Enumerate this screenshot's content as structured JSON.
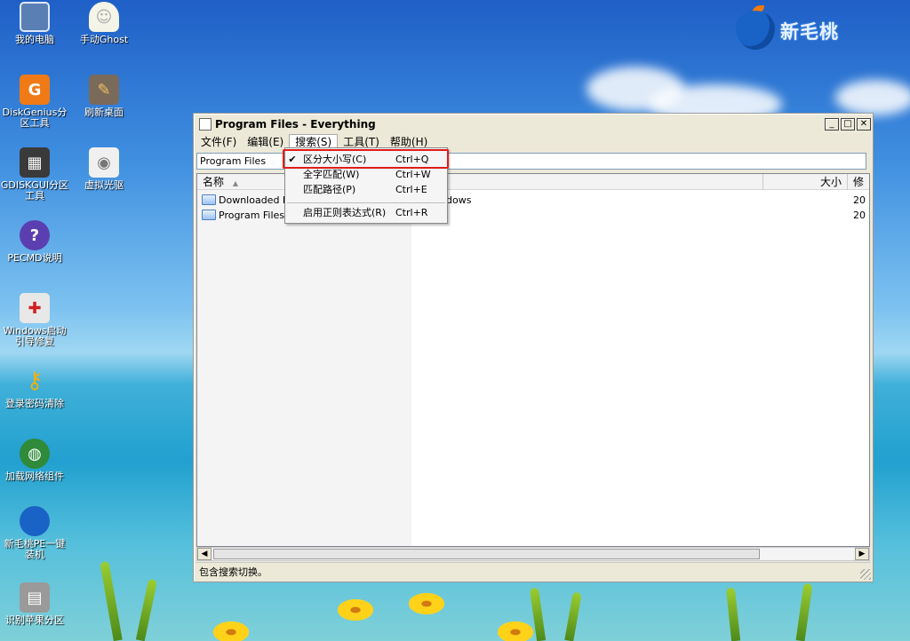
{
  "brand": {
    "name": "新毛桃"
  },
  "desktop_icons": [
    {
      "label": "我的电脑",
      "icon": "computer-icon"
    },
    {
      "label": "手动Ghost",
      "icon": "ghost-icon"
    },
    {
      "label": "DiskGenius分区工具",
      "icon": "diskgenius-icon"
    },
    {
      "label": "刷新桌面",
      "icon": "refresh-desktop-icon"
    },
    {
      "label": "GDISKGUI分区工具",
      "icon": "gdiskgui-icon"
    },
    {
      "label": "虚拟光驱",
      "icon": "virtual-cd-icon"
    },
    {
      "label": "PECMD说明",
      "icon": "help-icon"
    },
    {
      "label": "Windows启动引导修复",
      "icon": "boot-repair-icon"
    },
    {
      "label": "登录密码清除",
      "icon": "key-icon"
    },
    {
      "label": "加载网络组件",
      "icon": "network-icon"
    },
    {
      "label": "新毛桃PE一键装机",
      "icon": "peach-install-icon"
    },
    {
      "label": "识别苹果分区",
      "icon": "mac-partition-icon"
    }
  ],
  "window": {
    "title": "Program Files - Everything",
    "menu": [
      "文件(F)",
      "编辑(E)",
      "搜索(S)",
      "工具(T)",
      "帮助(H)"
    ],
    "search_value": "Program Files",
    "columns": {
      "name": "名称",
      "size": "大小",
      "modified": "修"
    },
    "rows": [
      {
        "name": "Downloaded Pro",
        "path": "dows",
        "date": "20"
      },
      {
        "name": "Program Files",
        "path": "",
        "date": "20"
      }
    ],
    "status": "包含搜索切换。"
  },
  "search_menu": [
    {
      "label": "区分大小写(C)",
      "shortcut": "Ctrl+Q",
      "checked": "✔"
    },
    {
      "label": "全字匹配(W)",
      "shortcut": "Ctrl+W",
      "checked": ""
    },
    {
      "label": "匹配路径(P)",
      "shortcut": "Ctrl+E",
      "checked": ""
    },
    {
      "label": "启用正则表达式(R)",
      "shortcut": "Ctrl+R",
      "checked": ""
    }
  ],
  "colors": {
    "highlight": "#e01b1b",
    "desktop_sky": "#1f5fc7",
    "desktop_sea": "#22a0cf"
  }
}
